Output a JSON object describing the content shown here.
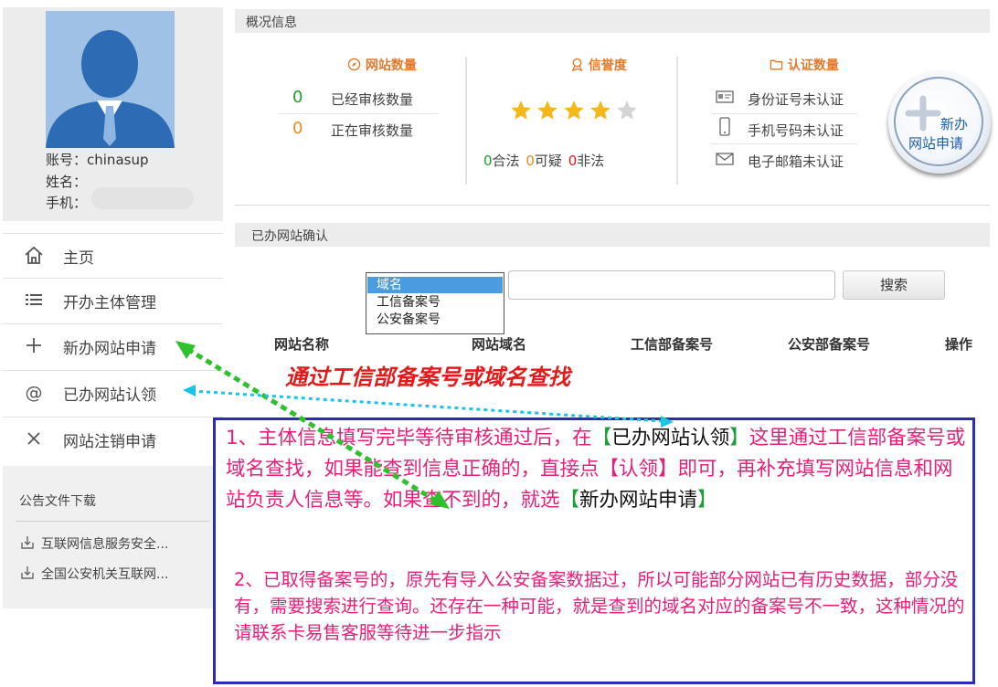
{
  "profile": {
    "account_label": "账号：",
    "account_value": "chinasup",
    "name_label": "姓名：",
    "phone_label": "手机："
  },
  "sidebar": {
    "items": [
      {
        "label": "主页",
        "icon": "home-icon"
      },
      {
        "label": "开办主体管理",
        "icon": "list-icon"
      },
      {
        "label": "新办网站申请",
        "icon": "plus-icon"
      },
      {
        "label": "已办网站认领",
        "icon": "at-icon"
      },
      {
        "label": "网站注销申请",
        "icon": "close-icon"
      }
    ],
    "announcements": {
      "header": "公告文件下载",
      "docs": [
        "互联网信息服务安全...",
        "全国公安机关互联网..."
      ]
    }
  },
  "overview": {
    "title": "概况信息",
    "site_count": {
      "title": "网站数量",
      "rows": [
        {
          "value": "0",
          "label": "已经审核数量"
        },
        {
          "value": "0",
          "label": "正在审核数量"
        }
      ]
    },
    "reputation": {
      "title": "信誉度",
      "stars_filled": 4,
      "stars_total": 5,
      "legal_count": "0",
      "legal_label": "合法",
      "suspect_count": "0",
      "suspect_label": "可疑",
      "illegal_count": "0",
      "illegal_label": "非法"
    },
    "verification": {
      "title": "认证数量",
      "items": [
        "身份证号未认证",
        "手机号码未认证",
        "电子邮箱未认证"
      ]
    },
    "new_site_button": {
      "line1": "新办",
      "line2": "网站申请"
    }
  },
  "confirmed": {
    "title": "已办网站确认",
    "select_options": [
      "域名",
      "工信备案号",
      "公安备案号"
    ],
    "selected_option": "域名",
    "search_value": "",
    "search_button": "搜索",
    "columns": [
      "网站名称",
      "网站域名",
      "工信部备案号",
      "公安部备案号",
      "操作"
    ],
    "hint": "通过工信部备案号或域名查找"
  },
  "note": {
    "p1_a": "1、主体信息填写完毕等待审核通过后，在",
    "p1_b": "【",
    "p1_c": "已办网站认领",
    "p1_d": "】",
    "p1_e": "这里通过工信部备案号或域名查找，如果能查到信息正确的，直接点【认领】即可，再补充填写网站信息和网站负责人信息等。如果查不到的，就选",
    "p1_f": "【",
    "p1_g": "新办网站申请",
    "p1_h": "】",
    "p2": "2、已取得备案号的，原先有导入公安备案数据过，所以可能部分网站已有历史数据，部分没有，需要搜索进行查询。还存在一种可能，就是查到的域名对应的备案号不一致，这种情况的请联系卡易售客服等待进一步指示"
  },
  "colors": {
    "accent_orange": "#e07a2e",
    "count_green": "#1f9e2a",
    "count_orange": "#ee8a1a",
    "star_gold": "#f4b81b",
    "note_pink": "#e6207a",
    "note_border": "#2b2bb8",
    "arrow_green": "#2ec12e",
    "arrow_cyan": "#19c4e4"
  }
}
